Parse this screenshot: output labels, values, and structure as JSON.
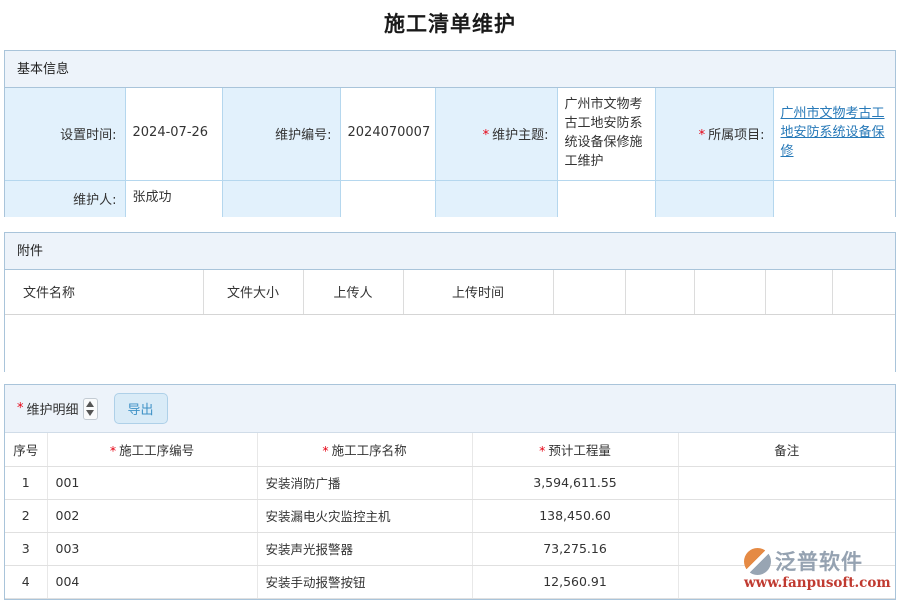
{
  "page": {
    "title": "施工清单维护"
  },
  "misc": {
    "required_marker": "*"
  },
  "sections": {
    "basic": {
      "title": "基本信息",
      "fields": [
        {
          "label": "设置时间:",
          "value": "2024-07-26"
        },
        {
          "label": "维护编号:",
          "value": "2024070007"
        },
        {
          "label": "维护主题:",
          "value": "广州市文物考古工地安防系统设备保修施工维护"
        },
        {
          "label": "所属项目:",
          "value": "广州市文物考古工地安防系统设备保修"
        },
        {
          "label": "维护人:",
          "value": "张成功"
        }
      ]
    },
    "attachments": {
      "title": "附件",
      "headers": [
        "文件名称",
        "文件大小",
        "上传人",
        "上传时间"
      ]
    },
    "details": {
      "title": "维护明细",
      "export_label": "导出",
      "headers": [
        "序号",
        "施工工序编号",
        "施工工序名称",
        "预计工程量",
        "备注"
      ],
      "rows": [
        [
          "1",
          "001",
          "安装消防广播",
          "3,594,611.55",
          ""
        ],
        [
          "2",
          "002",
          "安装漏电火灾监控主机",
          "138,450.60",
          ""
        ],
        [
          "3",
          "003",
          "安装声光报警器",
          "73,275.16",
          ""
        ],
        [
          "4",
          "004",
          "安装手动报警按钮",
          "12,560.91",
          ""
        ]
      ]
    }
  },
  "watermark": {
    "brand": "泛普软件",
    "url": "www.fanpusoft.com"
  }
}
